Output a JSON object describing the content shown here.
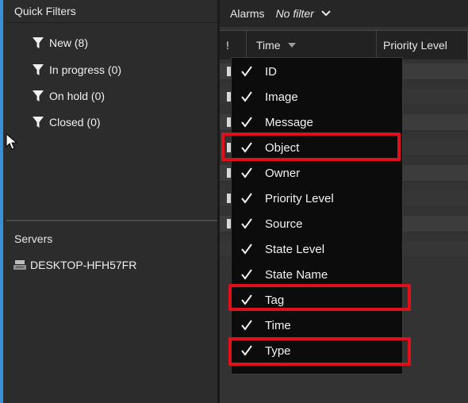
{
  "quick_filters": {
    "header": "Quick Filters",
    "items": [
      {
        "label": "New (8)",
        "icon": "filter-icon"
      },
      {
        "label": "In progress (0)",
        "icon": "filter-icon"
      },
      {
        "label": "On hold (0)",
        "icon": "filter-icon"
      },
      {
        "label": "Closed (0)",
        "icon": "filter-icon"
      }
    ]
  },
  "servers": {
    "header": "Servers",
    "items": [
      {
        "label": "DESKTOP-HFH57FR",
        "icon": "server-icon"
      }
    ]
  },
  "alarms": {
    "title": "Alarms",
    "filter": "No filter"
  },
  "columns": {
    "bang": "!",
    "time": "Time",
    "priority": "Priority Level"
  },
  "column_menu": {
    "items": [
      {
        "label": "ID",
        "checked": true,
        "highlighted": false
      },
      {
        "label": "Image",
        "checked": true,
        "highlighted": false
      },
      {
        "label": "Message",
        "checked": true,
        "highlighted": false
      },
      {
        "label": "Object",
        "checked": true,
        "highlighted": true
      },
      {
        "label": "Owner",
        "checked": true,
        "highlighted": false
      },
      {
        "label": "Priority Level",
        "checked": true,
        "highlighted": false
      },
      {
        "label": "Source",
        "checked": true,
        "highlighted": false
      },
      {
        "label": "State Level",
        "checked": true,
        "highlighted": false
      },
      {
        "label": "State Name",
        "checked": true,
        "highlighted": false
      },
      {
        "label": "Tag",
        "checked": true,
        "highlighted": true
      },
      {
        "label": "Time",
        "checked": true,
        "highlighted": false
      },
      {
        "label": "Type",
        "checked": true,
        "highlighted": true
      }
    ]
  },
  "colors": {
    "accent": "#3a8fd6",
    "highlight": "#e0101a",
    "menu_background": "#0c0c0c"
  }
}
